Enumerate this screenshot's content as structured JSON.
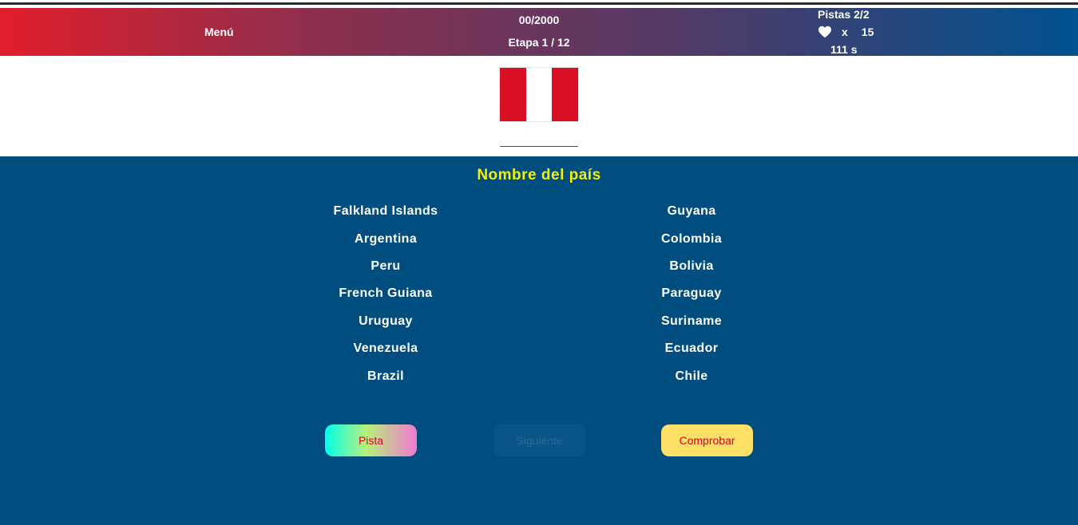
{
  "header": {
    "menu_label": "Menú",
    "score": "00/2000",
    "stage": "Etapa 1 / 12",
    "hints": "Pistas 2/2",
    "lives_x": "x",
    "lives_count": "15",
    "timer": "111 s"
  },
  "flag": {
    "country_flag": "Peru",
    "colors": [
      "#d91023",
      "#ffffff",
      "#d91023"
    ]
  },
  "question": {
    "title": "Nombre del país"
  },
  "options": {
    "left": [
      "Falkland Islands",
      "Argentina",
      "Peru",
      "French Guiana",
      "Uruguay",
      "Venezuela",
      "Brazil"
    ],
    "right": [
      "Guyana",
      "Colombia",
      "Bolivia",
      "Paraguay",
      "Suriname",
      "Ecuador",
      "Chile"
    ]
  },
  "buttons": {
    "hint": "Pista",
    "next": "Siguiente",
    "check": "Comprobar"
  },
  "colors": {
    "background": "#004d80",
    "title": "#f4f000",
    "accent_red": "#d80027",
    "check_button": "#ffe066"
  }
}
